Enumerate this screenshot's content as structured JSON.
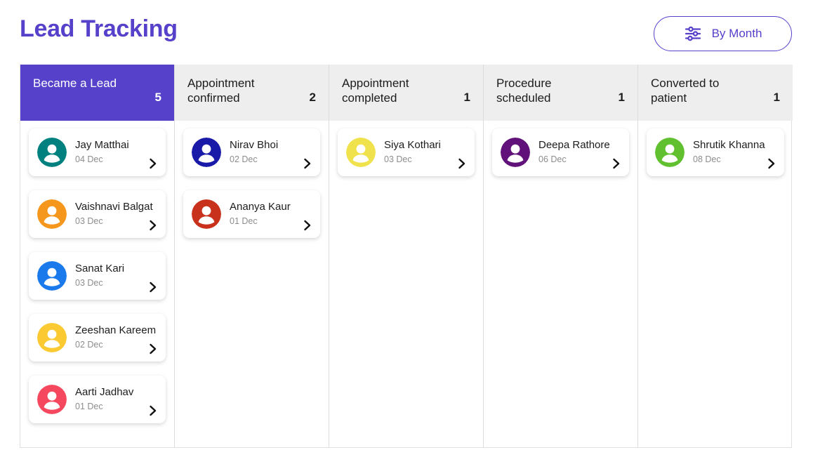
{
  "header": {
    "title": "Lead Tracking",
    "title_color": "#5641ca",
    "filter_button": {
      "label": "By Month",
      "icon": "sliders-icon",
      "accent_color": "#5641ca"
    }
  },
  "board": {
    "active_column_color": "#5641ca",
    "inactive_column_color": "#eeeeee",
    "columns": [
      {
        "id": "became-a-lead",
        "title": "Became a Lead",
        "count": "5",
        "active": true,
        "cards": [
          {
            "name": "Jay Matthai",
            "date": "04 Dec",
            "avatar_color": "#00807f"
          },
          {
            "name": "Vaishnavi Balgat",
            "date": "03 Dec",
            "avatar_color": "#f5971d"
          },
          {
            "name": "Sanat Kari",
            "date": "03 Dec",
            "avatar_color": "#1a7aeb"
          },
          {
            "name": "Zeeshan Kareem",
            "date": "02 Dec",
            "avatar_color": "#fbc931"
          },
          {
            "name": "Aarti Jadhav",
            "date": "01 Dec",
            "avatar_color": "#f5485e"
          }
        ]
      },
      {
        "id": "appointment-confirmed",
        "title": "Appointment confirmed",
        "count": "2",
        "active": false,
        "cards": [
          {
            "name": "Nirav Bhoi",
            "date": "02 Dec",
            "avatar_color": "#1a1aa8"
          },
          {
            "name": "Ananya Kaur",
            "date": "01 Dec",
            "avatar_color": "#c8311b"
          }
        ]
      },
      {
        "id": "appointment-completed",
        "title": "Appointment completed",
        "count": "1",
        "active": false,
        "cards": [
          {
            "name": "Siya Kothari",
            "date": "03 Dec",
            "avatar_color": "#f0e24d"
          }
        ]
      },
      {
        "id": "procedure-scheduled",
        "title": "Procedure scheduled",
        "count": "1",
        "active": false,
        "cards": [
          {
            "name": "Deepa Rathore",
            "date": "06 Dec",
            "avatar_color": "#61117a"
          }
        ]
      },
      {
        "id": "converted-to-patient",
        "title": "Converted to patient",
        "count": "1",
        "active": false,
        "cards": [
          {
            "name": "Shrutik Khanna",
            "date": "08 Dec",
            "avatar_color": "#60c030"
          }
        ]
      }
    ]
  },
  "icons": {
    "card_chevron": "chevron-right-icon",
    "avatar": "person-avatar-icon"
  }
}
